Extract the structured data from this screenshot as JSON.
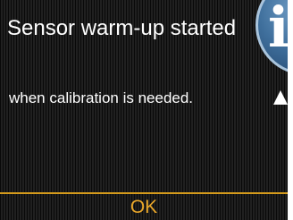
{
  "dialog": {
    "title": "Sensor warm-up started",
    "message": "when calibration is needed.",
    "info_icon": "info-icon",
    "info_letter": "i",
    "scroll_icon": "triangle-up-icon",
    "ok_label": "OK"
  },
  "colors": {
    "screen_background": "#141414",
    "text": "#ffffff",
    "accent": "#d49a1c",
    "ok_text": "#e8a62a",
    "info_badge": "#3f6f9c"
  }
}
